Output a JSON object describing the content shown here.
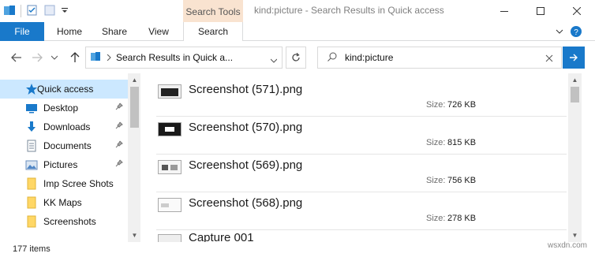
{
  "window": {
    "title": "kind:picture - Search Results in Quick access",
    "context_tab_group": "Search Tools"
  },
  "ribbon": {
    "tabs": [
      {
        "label": "File"
      },
      {
        "label": "Home"
      },
      {
        "label": "Share"
      },
      {
        "label": "View"
      },
      {
        "label": "Search"
      }
    ]
  },
  "address": {
    "text": "Search Results in Quick a..."
  },
  "search": {
    "value": "kind:picture"
  },
  "sidebar": {
    "items": [
      {
        "label": "Quick access",
        "icon": "star-icon",
        "pinned": false,
        "selected": true
      },
      {
        "label": "Desktop",
        "icon": "desktop-icon",
        "pinned": true
      },
      {
        "label": "Downloads",
        "icon": "download-icon",
        "pinned": true
      },
      {
        "label": "Documents",
        "icon": "documents-icon",
        "pinned": true
      },
      {
        "label": "Pictures",
        "icon": "pictures-icon",
        "pinned": true
      },
      {
        "label": "Imp Scree Shots",
        "icon": "folder-icon",
        "pinned": false
      },
      {
        "label": "KK Maps",
        "icon": "folder-icon",
        "pinned": false
      },
      {
        "label": "Screenshots",
        "icon": "folder-icon",
        "pinned": false
      }
    ]
  },
  "results": {
    "size_label": "Size:",
    "items": [
      {
        "name": "Screenshot (571).png",
        "size": "726 KB"
      },
      {
        "name": "Screenshot (570).png",
        "size": "815 KB"
      },
      {
        "name": "Screenshot (569).png",
        "size": "756 KB"
      },
      {
        "name": "Screenshot (568).png",
        "size": "278 KB"
      },
      {
        "name": "Capture 001",
        "size": ""
      }
    ]
  },
  "status": {
    "item_count": "177 items"
  },
  "watermark": "wsxdn.com",
  "colors": {
    "accent": "#1979ca",
    "selection": "#cce8ff",
    "context_tab": "#f9e3d0",
    "folder": "#ffd766"
  }
}
